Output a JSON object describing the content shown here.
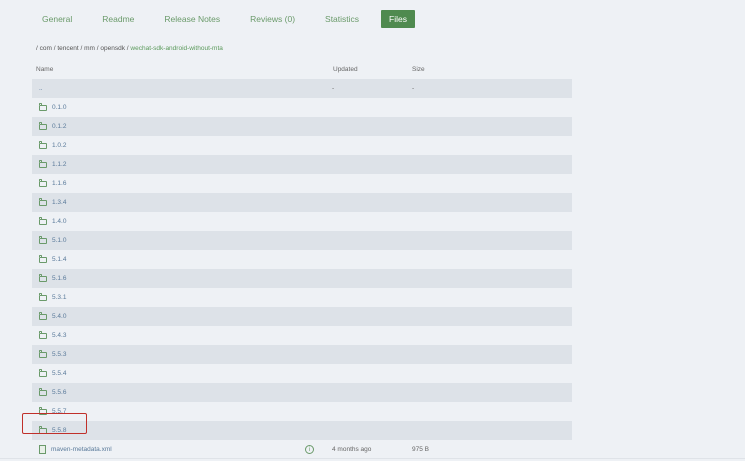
{
  "tabs": [
    {
      "label": "General"
    },
    {
      "label": "Readme"
    },
    {
      "label": "Release Notes"
    },
    {
      "label": "Reviews (0)"
    },
    {
      "label": "Statistics"
    },
    {
      "label": "Files",
      "active": true
    }
  ],
  "breadcrumb": {
    "parts": [
      "com",
      "tencent",
      "mm",
      "opensdk"
    ],
    "current": "wechat-sdk-android-without-mta"
  },
  "table": {
    "headers": {
      "name": "Name",
      "updated": "Updated",
      "size": "Size"
    },
    "parent": {
      "name": "..",
      "updated": "-",
      "size": "-"
    },
    "folders": [
      "0.1.0",
      "0.1.2",
      "1.0.2",
      "1.1.2",
      "1.1.6",
      "1.3.4",
      "1.4.0",
      "5.1.0",
      "5.1.4",
      "5.1.6",
      "5.3.1",
      "5.4.0",
      "5.4.3",
      "5.5.3",
      "5.5.4",
      "5.5.6",
      "5.5.7",
      "5.5.8"
    ],
    "file": {
      "name": "maven-metadata.xml",
      "updated": "4 months ago",
      "size": "975 B"
    }
  },
  "colors": {
    "accent": "#4f8a4f",
    "highlight": "#c0302a"
  },
  "icons": {
    "folder": "folder-icon",
    "file": "file-icon",
    "info": "info-icon"
  }
}
